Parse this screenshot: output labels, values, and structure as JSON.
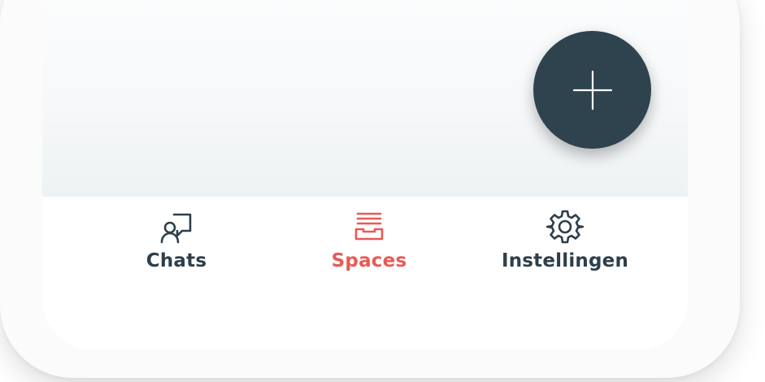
{
  "fab": {
    "icon": "plus-icon",
    "color": "#2f434e"
  },
  "tabs": [
    {
      "label": "Chats",
      "icon": "chat-person-icon",
      "active": false
    },
    {
      "label": "Spaces",
      "icon": "inbox-tray-icon",
      "active": true
    },
    {
      "label": "Instellingen",
      "icon": "gear-icon",
      "active": false
    }
  ],
  "colors": {
    "active": "#e85a55",
    "inactive": "#2e3f4b",
    "fab": "#2f434e"
  }
}
